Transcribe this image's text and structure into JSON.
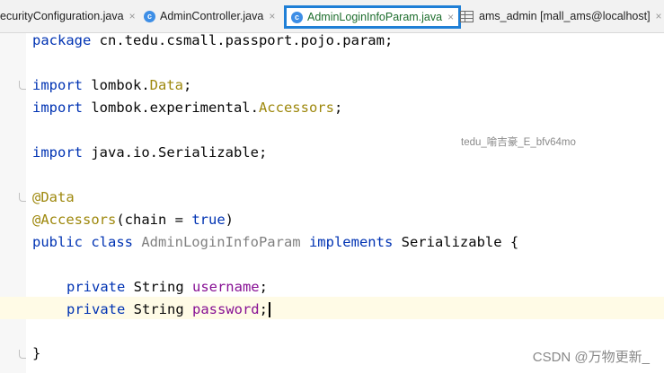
{
  "tabs": [
    {
      "label": "ecurityConfiguration.java",
      "active": false
    },
    {
      "label": "AdminController.java",
      "active": false
    },
    {
      "label": "AdminLoginInfoParam.java",
      "active": true
    },
    {
      "label": "ams_admin [mall_ams@localhost]",
      "active": false
    }
  ],
  "tab_close_glyph": "×",
  "tab_icon_letter": "c",
  "code": {
    "l1_kw": "package",
    "l1_rest": " cn.tedu.csmall.passport.pojo.param;",
    "l2_kw": "import",
    "l2_a": " lombok.",
    "l2_b": "Data",
    "l2_c": ";",
    "l3_kw": "import",
    "l3_a": " lombok.experimental.",
    "l3_b": "Accessors",
    "l3_c": ";",
    "l4_kw": "import",
    "l4_a": " java.io.Serializable;",
    "l5": "@Data",
    "l6_a": "@Accessors",
    "l6_b": "(chain = ",
    "l6_kw": "true",
    "l6_c": ")",
    "l7_kw1": "public class",
    "l7_cls": " AdminLoginInfoParam ",
    "l7_kw2": "implements",
    "l7_rest": " Serializable {",
    "l8_kw": "private",
    "l8_type": " String ",
    "l8_fld": "username",
    "l8_end": ";",
    "l9_kw": "private",
    "l9_type": " String ",
    "l9_fld": "password",
    "l9_end": ";",
    "l10": "}"
  },
  "watermark_mid": "tedu_喻吉豪_E_bfv64mo",
  "watermark_csdn": "CSDN @万物更新_"
}
